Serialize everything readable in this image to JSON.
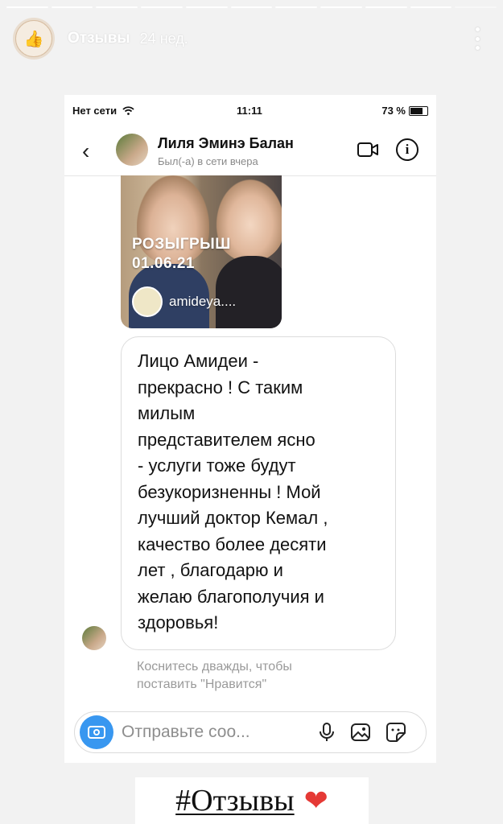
{
  "story": {
    "segments": 11,
    "author": "Отзывы",
    "time": "24 нед.",
    "tag": "#Отзывы",
    "colors": {
      "background": "#f2f2f2",
      "heart": "#e53935"
    }
  },
  "phone_status": {
    "carrier": "Нет сети",
    "time": "11:11",
    "battery": "73 %"
  },
  "dm": {
    "contact_name": "Лиля Эминэ Балан",
    "contact_status": "Был(-а) в сети вчера",
    "shared_story": {
      "title_line1": "РОЗЫГРЫШ",
      "title_line2": "01.06.21",
      "account": "amideya...."
    },
    "message": "Лицо Амидеи -\nпрекрасно ! С таким\nмилым\nпредставителем ясно\n- услуги тоже будут\nбезукоризненны ! Мой\nлучший доктор Кемал ,\nкачество более десяти\nлет , благодарю и\nжелаю благополучия и\nздоровья!",
    "hint": "Коснитесь дважды, чтобы\nпоставить \"Нравится\"",
    "composer_placeholder": "Отправьте соо...",
    "accent": "#3897f0"
  }
}
